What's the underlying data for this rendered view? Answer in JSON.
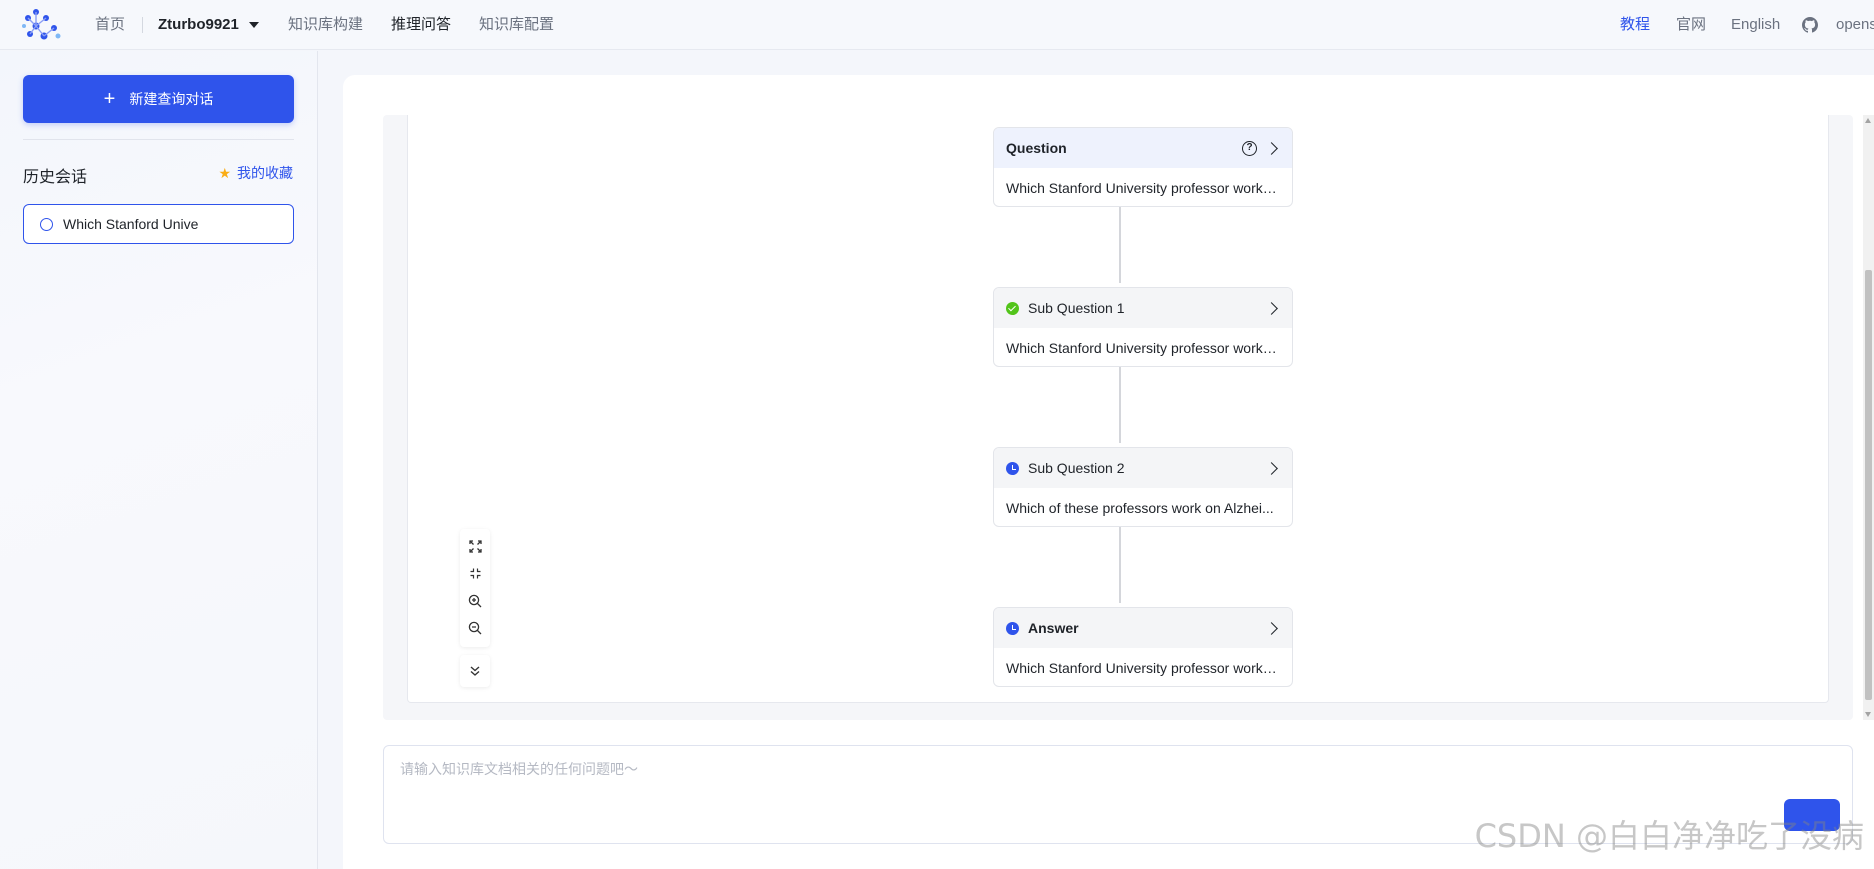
{
  "nav": {
    "home": "首页",
    "user": "Zturbo9921",
    "kb_build": "知识库构建",
    "reasoning_qa": "推理问答",
    "kb_config": "知识库配置",
    "tutorial": "教程",
    "website": "官网",
    "language": "English",
    "opens": "opens"
  },
  "sidebar": {
    "new_chat_label": "新建查询对话",
    "history_title": "历史会话",
    "favorites_label": "我的收藏",
    "history_items": [
      {
        "label": "Which Stanford Unive"
      }
    ]
  },
  "flow": {
    "nodes": [
      {
        "title": "Question",
        "body": "Which Stanford University professor works...",
        "status": "none"
      },
      {
        "title": "Sub Question 1",
        "body": "Which Stanford University professor works...",
        "status": "done"
      },
      {
        "title": "Sub Question 2",
        "body": "Which of these professors work on Alzhei...",
        "status": "pending"
      },
      {
        "title": "Answer",
        "body": "Which Stanford University professor works...",
        "status": "pending"
      }
    ]
  },
  "input": {
    "placeholder": "请输入知识库文档相关的任何问题吧～"
  },
  "watermark": "CSDN @白白净净吃了没病",
  "colors": {
    "accent": "#2f54eb",
    "success": "#52c41a",
    "star": "#faad14"
  }
}
